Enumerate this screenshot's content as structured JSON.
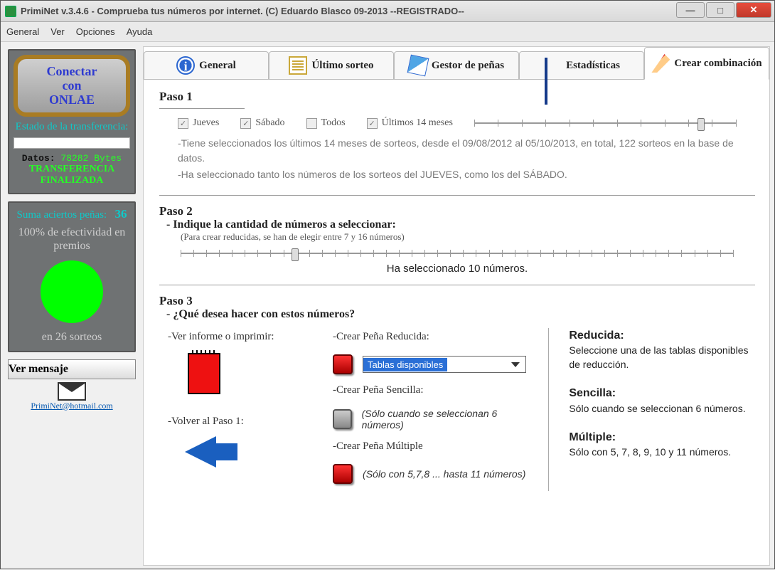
{
  "window": {
    "title": "PrimiNet v.3.4.6 - Comprueba tus números por internet. (C) Eduardo Blasco 09-2013  --REGISTRADO--"
  },
  "menu": {
    "general": "General",
    "ver": "Ver",
    "opciones": "Opciones",
    "ayuda": "Ayuda"
  },
  "sidebar": {
    "connect_line1": "Conectar",
    "connect_line2": "con",
    "connect_line3": "ONLAE",
    "transfer_label": "Estado de la transferencia:",
    "datos_label": "Datos:",
    "datos_value": "78282 Bytes",
    "finalizada": "TRANSFERENCIA FINALIZADA",
    "suma_line": "Suma aciertos peñas:",
    "suma_value": "36",
    "efect_line": "100% de efectividad en premios",
    "sorteos_line": "en 26 sorteos",
    "ver_mensaje": "Ver mensaje",
    "email": "PrimiNet@hotmail.com"
  },
  "tabs": {
    "general": "General",
    "ultimo": "Último sorteo",
    "gestor": "Gestor de peñas",
    "estad": "Estadísticas",
    "crear": "Crear combinación"
  },
  "step1": {
    "title": "Paso 1",
    "jueves": "Jueves",
    "sabado": "Sábado",
    "todos": "Todos",
    "ultimos": "Últimos 14 meses",
    "note1": "-Tiene seleccionados los últimos 14 meses de sorteos, desde el 09/08/2012 al 05/10/2013, en total, 122 sorteos en la base de datos.",
    "note2": "-Ha seleccionado tanto los números de los sorteos del JUEVES, como los del SÁBADO.",
    "slider_pos_pct": "85"
  },
  "step2": {
    "title": "Paso 2",
    "subtitle": "- Indique la cantidad de números a seleccionar:",
    "hint": "(Para crear reducidas, se han de elegir entre 7 y 16 números)",
    "selected": "Ha seleccionado 10 números.",
    "slider_pos_pct": "20"
  },
  "step3": {
    "title": "Paso 3",
    "subtitle": "- ¿Qué desea hacer con estos números?",
    "ver_informe": "-Ver informe o imprimir:",
    "volver": "-Volver al Paso 1:",
    "crear_reducida": "-Crear Peña Reducida:",
    "tablas": "Tablas disponibles",
    "crear_sencilla": "-Crear Peña Sencilla:",
    "sencilla_note": "(Sólo cuando se seleccionan 6 números)",
    "crear_multiple": "-Crear Peña Múltiple",
    "multiple_note": "(Sólo con 5,7,8 ... hasta 11 números)",
    "help_reducida_t": "Reducida:",
    "help_reducida": "Seleccione una de las tablas disponibles de reducción.",
    "help_sencilla_t": "Sencilla:",
    "help_sencilla": "Sólo cuando se seleccionan 6 números.",
    "help_multiple_t": "Múltiple:",
    "help_multiple": "Sólo con 5, 7, 8, 9, 10 y 11 números."
  }
}
